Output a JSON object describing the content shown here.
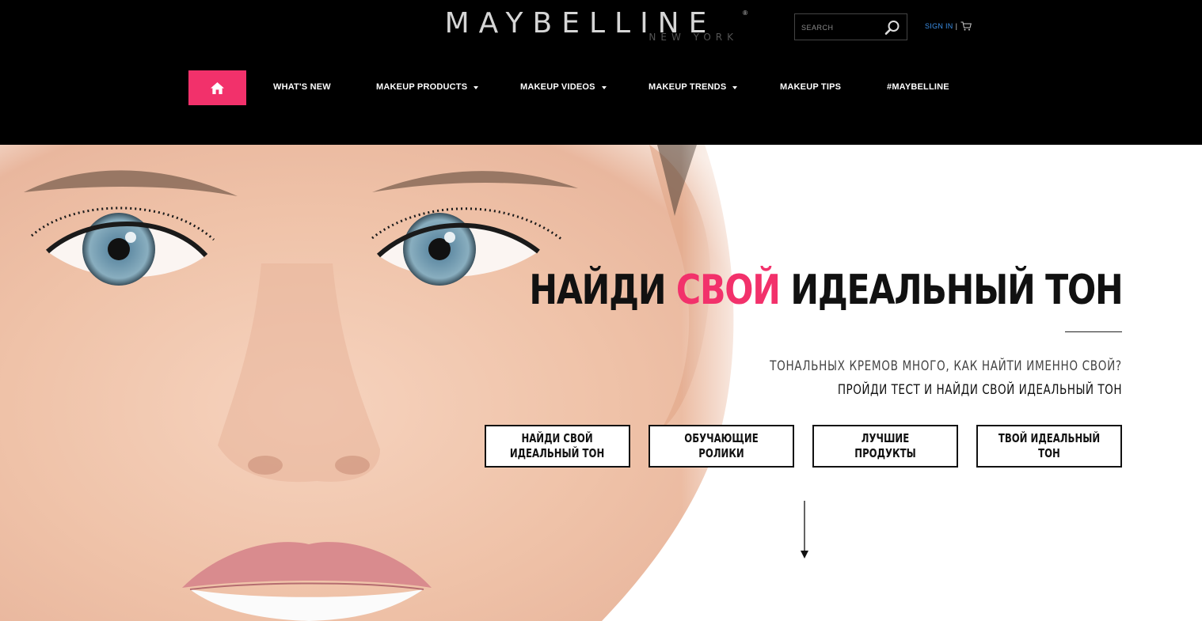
{
  "brand": {
    "name": "MAYBELLINE",
    "sub": "NEW YORK",
    "trademark": "®",
    "accent_color": "#f2316b"
  },
  "search": {
    "placeholder": "SEARCH",
    "icon": "search-icon"
  },
  "account": {
    "signin_label": "SIGN IN",
    "separator": "|",
    "cart_icon": "cart-icon"
  },
  "nav": {
    "home_icon": "home-icon",
    "items": [
      {
        "label": "WHAT'S NEW",
        "dropdown": false
      },
      {
        "label": "MAKEUP PRODUCTS",
        "dropdown": true
      },
      {
        "label": "MAKEUP VIDEOS",
        "dropdown": true
      },
      {
        "label": "MAKEUP TRENDS",
        "dropdown": true
      },
      {
        "label": "MAKEUP TIPS",
        "dropdown": false
      },
      {
        "label": "#MAYBELLINE",
        "dropdown": false
      }
    ]
  },
  "hero": {
    "headline_part1": "НАЙДИ ",
    "headline_accent": "СВОЙ",
    "headline_part2": " ИДЕАЛЬНЫЙ ТОН",
    "subtitle_1": "ТОНАЛЬНЫХ КРЕМОВ МНОГО, КАК НАЙТИ ИМЕННО СВОЙ?",
    "subtitle_2": "ПРОЙДИ ТЕСТ И НАЙДИ СВОЙ ИДЕАЛЬНЫЙ ТОН",
    "buttons": [
      "НАЙДИ СВОЙ\nИДЕАЛЬНЫЙ ТОН",
      "ОБУЧАЮЩИЕ РОЛИКИ",
      "ЛУЧШИЕ ПРОДУКТЫ",
      "ТВОЙ ИДЕАЛЬНЫЙ ТОН"
    ],
    "scroll_icon": "arrow-down-icon"
  }
}
